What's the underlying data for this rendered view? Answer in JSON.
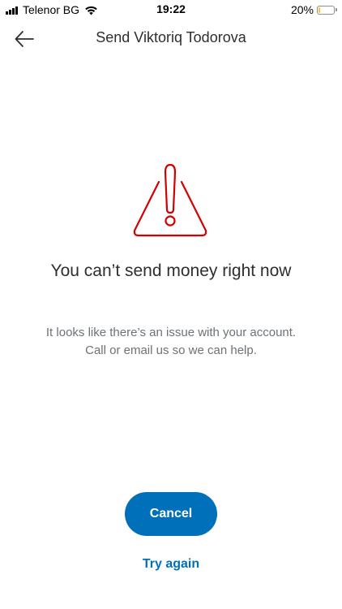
{
  "status_bar": {
    "carrier": "Telenor BG",
    "time": "19:22",
    "battery_percent": "20%",
    "battery_level": 0.2,
    "battery_fill_color": "#f7c331",
    "signal_icon": "signal-bars-icon",
    "wifi_icon": "wifi-icon"
  },
  "header": {
    "back_icon": "arrow-left-icon",
    "title": "Send Viktoriq Todorova"
  },
  "error": {
    "icon": "warning-triangle-icon",
    "icon_color": "#d20000",
    "heading": "You can’t send money right now",
    "message_line1": "It looks like there’s an issue with your account.",
    "message_line2": "Call or email us so we can help."
  },
  "actions": {
    "cancel_label": "Cancel",
    "try_again_label": "Try again",
    "accent_color": "#0070ba"
  }
}
